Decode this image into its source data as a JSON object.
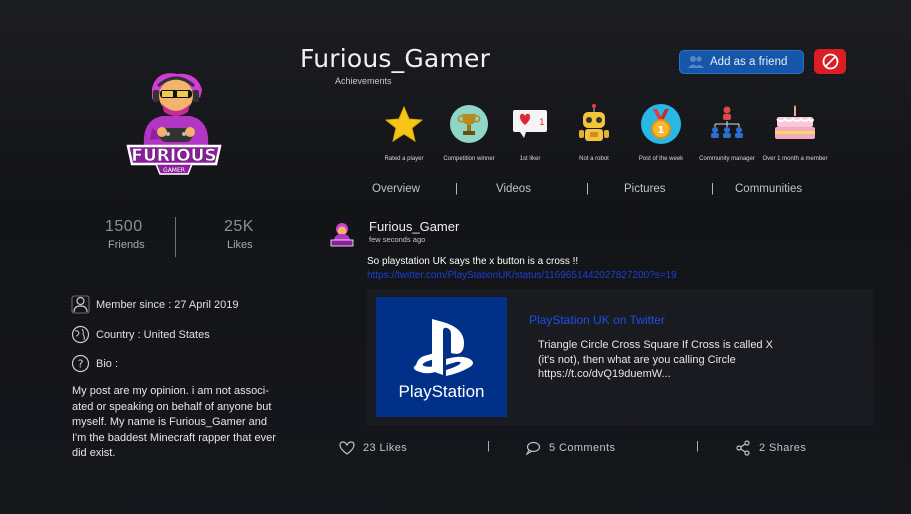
{
  "profile": {
    "name": "Furious_Gamer",
    "achievements_label": "Achievements",
    "logo_text_main": "FURIOUS",
    "logo_text_sub": "GAMER"
  },
  "actions": {
    "add_friend_label": "Add as a  friend"
  },
  "achievements": [
    {
      "label": "Rated a player",
      "icon": "star-icon"
    },
    {
      "label": "Competition winner",
      "icon": "trophy-icon"
    },
    {
      "label": "1st liker",
      "icon": "heart-bubble-icon"
    },
    {
      "label": "Not a robot",
      "icon": "robot-icon"
    },
    {
      "label": "Post of the week",
      "icon": "medal-icon"
    },
    {
      "label": "Community manager",
      "icon": "org-chart-icon"
    },
    {
      "label": "Over 1 month a member",
      "icon": "cake-icon"
    }
  ],
  "tabs": [
    "Overview",
    "Videos",
    "Pictures",
    "Communities"
  ],
  "stats": {
    "friends_count": "1500",
    "friends_label": "Friends",
    "likes_count": "25K",
    "likes_label": "Likes"
  },
  "info": {
    "member_since": "Member since : 27 April 2019",
    "country": "Country : United States",
    "bio_label": "Bio :",
    "bio_text": "My post are my opinion. i am not associ-ated or speaking on behalf of anyone but myself.  My name is Furious_Gamer and I'm the baddest Minecraft rapper that ever did exist."
  },
  "post": {
    "author": "Furious_Gamer",
    "time": "few seconds ago",
    "text": "So playstation UK says the x button is a cross !!",
    "link": "https://twitter.com/PlayStationUK/status/1169651442027827200?s=19",
    "card_title": "PlayStation UK on Twitter",
    "card_desc": "Triangle Circle Cross Square If Cross is called X (it's not), then what are you calling Circle https://t.co/dvQ19duemW...",
    "image_brand": "PlayStation"
  },
  "footer": {
    "likes": "23  Likes",
    "comments": "5  Comments",
    "shares": "2  Shares",
    "separator": "|"
  },
  "colors": {
    "background": "#131418",
    "accent_blue": "#1556a8",
    "block_red": "#d91e24",
    "link_blue": "#1c3fd6",
    "playstation_blue": "#003087"
  }
}
